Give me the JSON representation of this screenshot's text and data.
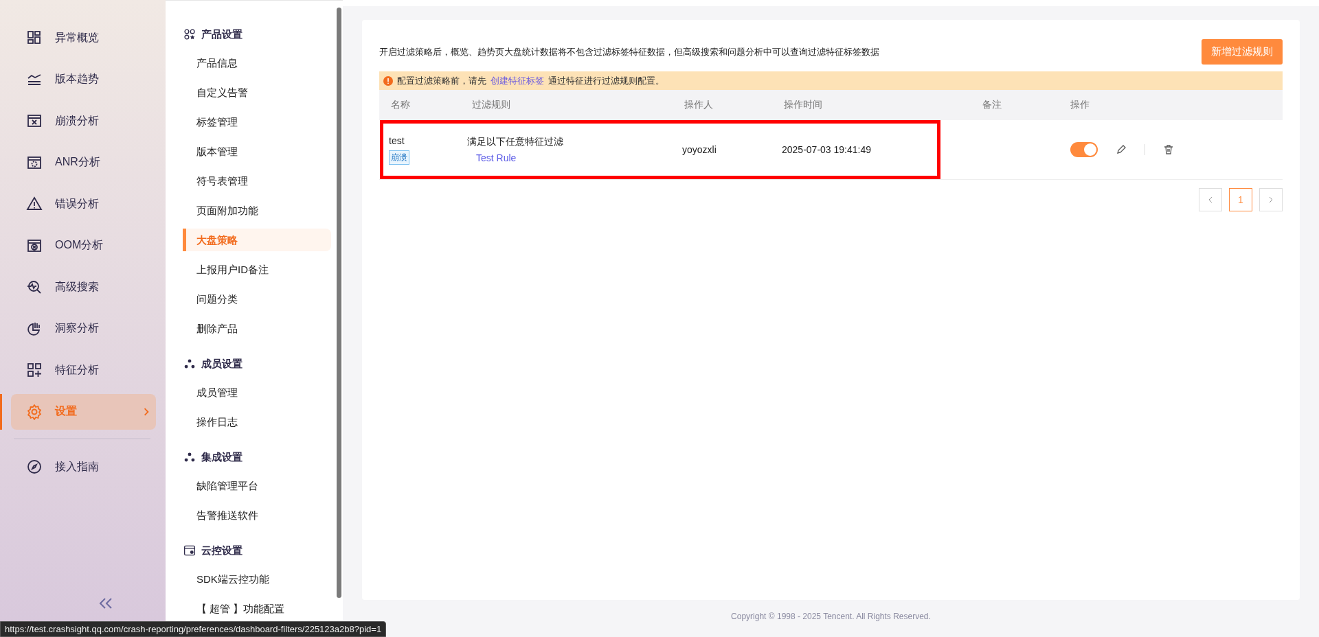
{
  "nav": {
    "items": [
      {
        "label": "异常概览",
        "selected": false
      },
      {
        "label": "版本趋势",
        "selected": false
      },
      {
        "label": "崩溃分析",
        "selected": false
      },
      {
        "label": "ANR分析",
        "selected": false
      },
      {
        "label": "错误分析",
        "selected": false
      },
      {
        "label": "OOM分析",
        "selected": false
      },
      {
        "label": "高级搜索",
        "selected": false
      },
      {
        "label": "洞察分析",
        "selected": false
      },
      {
        "label": "特征分析",
        "selected": false
      },
      {
        "label": "设置",
        "selected": true
      },
      {
        "label": "接入指南",
        "selected": false
      }
    ]
  },
  "settings_menu": {
    "groups": [
      {
        "title": "产品设置",
        "items": [
          {
            "label": "产品信息",
            "selected": false
          },
          {
            "label": "自定义告警",
            "selected": false
          },
          {
            "label": "标签管理",
            "selected": false
          },
          {
            "label": "版本管理",
            "selected": false
          },
          {
            "label": "符号表管理",
            "selected": false
          },
          {
            "label": "页面附加功能",
            "selected": false
          },
          {
            "label": "大盘策略",
            "selected": true
          },
          {
            "label": "上报用户ID备注",
            "selected": false
          },
          {
            "label": "问题分类",
            "selected": false
          },
          {
            "label": "删除产品",
            "selected": false
          }
        ]
      },
      {
        "title": "成员设置",
        "items": [
          {
            "label": "成员管理",
            "selected": false
          },
          {
            "label": "操作日志",
            "selected": false
          }
        ]
      },
      {
        "title": "集成设置",
        "items": [
          {
            "label": "缺陷管理平台",
            "selected": false
          },
          {
            "label": "告警推送软件",
            "selected": false
          }
        ]
      },
      {
        "title": "云控设置",
        "items": [
          {
            "label": "SDK端云控功能",
            "selected": false
          },
          {
            "label": "【 超管 】功能配置",
            "selected": false
          }
        ]
      }
    ]
  },
  "content": {
    "description": "开启过滤策略后，概览、趋势页大盘统计数据将不包含过滤标签特征数据，但高级搜索和问题分析中可以查询过滤特征标签数据",
    "add_button": "新增过滤规则",
    "notice": {
      "before": "配置过滤策略前，请先",
      "link": "创建特征标签",
      "after": "通过特征进行过滤规则配置。"
    },
    "table": {
      "columns": [
        "名称",
        "过滤规则",
        "操作人",
        "操作时间",
        "备注",
        "操作"
      ],
      "rows": [
        {
          "name": "test",
          "tag": "崩溃",
          "rule": "满足以下任意特征过滤",
          "rule_item": "Test Rule",
          "operator": "yoyozxli",
          "time": "2025-07-03 19:41:49",
          "enabled": true,
          "highlighted": true
        }
      ]
    },
    "pagination": {
      "pages": [
        {
          "label": "1",
          "selected": true
        }
      ]
    }
  },
  "footer": "Copyright © 1998 - 2025 Tencent. All Rights Reserved.",
  "status_url": "https://test.crashsight.qq.com/crash-reporting/preferences/dashboard-filters/225123a2b8?pid=1"
}
